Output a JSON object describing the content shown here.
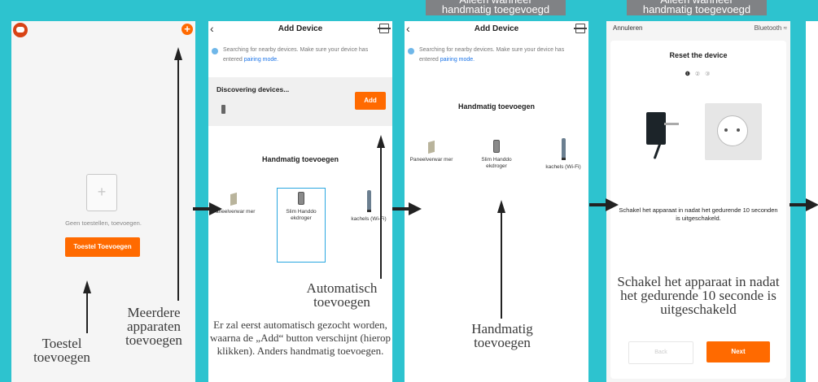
{
  "screen1": {
    "empty_text": "Geen toestellen, toevoegen.",
    "add_button": "Toestel Toevoegen",
    "annot_add": "Toestel toevoegen",
    "annot_multi": "Meerdere apparaten toevoegen"
  },
  "screen2": {
    "title": "Add Device",
    "search_text": "Searching for nearby devices. Make sure your device has entered",
    "pairing_link": "pairing mode.",
    "discovering": "Discovering devices...",
    "add_button": "Add",
    "manual_title": "Handmatig toevoegen",
    "devices": [
      "Paneelverwar mer",
      "Slim Handdo ekdroger",
      "kachels (Wi-Fi)"
    ],
    "annot_auto": "Automatisch toevoegen",
    "annot_desc": "Er zal eerst automatisch gezocht worden, waarna de „Add“ button verschijnt (hierop klikken). Anders handmatig toevoegen."
  },
  "screen3": {
    "title": "Add Device",
    "search_text": "Searching for nearby devices. Make sure your device has entered",
    "pairing_link": "pairing mode.",
    "manual_title": "Handmatig toevoegen",
    "devices": [
      "Paneelverwar mer",
      "Slim Handdo ekdroger",
      "kachels (Wi-Fi)"
    ],
    "top_label": "Alleen wanneer handmatig toegevoegd",
    "top_label_cut": "Alleen wanneer",
    "top_label_main": "handmatig toegevoegd",
    "annot_manual": "Handmatig toevoegen"
  },
  "screen4": {
    "cancel": "Annuleren",
    "bluetooth": "Bluetooth ≈",
    "title": "Reset the device",
    "steps": [
      "❶",
      "②",
      "③"
    ],
    "instruction": "Schakel het apparaat in nadat het gedurende 10 seconden is uitgeschakeld.",
    "back_button": "Back",
    "next_button": "Next",
    "top_label_cut": "Alleen wanneer",
    "top_label_main": "handmatig toegevoegd",
    "annot_instruction": "Schakel het apparaat in nadat het gedurende 10 seconde is uitgeschakeld"
  },
  "colors": {
    "background": "#2dc3cf",
    "accent": "#ff6a00",
    "link": "#1a73e8",
    "label_gray": "#808285"
  }
}
